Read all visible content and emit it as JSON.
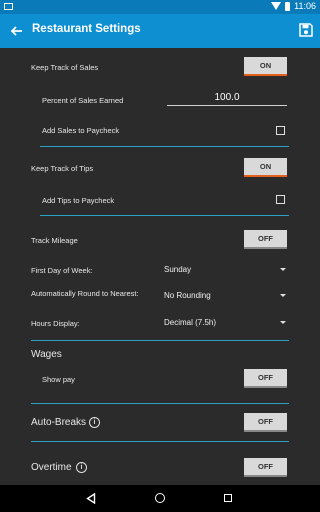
{
  "status_bar": {
    "time": "11:06"
  },
  "app_bar": {
    "title": "Restaurant Settings"
  },
  "settings": {
    "keep_track_sales": {
      "label": "Keep Track of Sales",
      "value": "ON"
    },
    "percent_sales": {
      "label": "Percent of Sales Earned",
      "value": "100.0"
    },
    "add_sales_paycheck": {
      "label": "Add Sales to Paycheck",
      "checked": false
    },
    "keep_track_tips": {
      "label": "Keep Track of Tips",
      "value": "ON"
    },
    "add_tips_paycheck": {
      "label": "Add Tips to Paycheck",
      "checked": false
    },
    "track_mileage": {
      "label": "Track Mileage",
      "value": "OFF"
    },
    "first_day": {
      "label": "First Day of Week:",
      "value": "Sunday"
    },
    "round_nearest": {
      "label": "Automatically Round to Nearest:",
      "value": "No Rounding"
    },
    "hours_display": {
      "label": "Hours Display:",
      "value": "Decimal (7.5h)"
    }
  },
  "wages": {
    "heading": "Wages",
    "show_pay": {
      "label": "Show pay",
      "value": "OFF"
    }
  },
  "auto_breaks": {
    "label": "Auto-Breaks",
    "value": "OFF",
    "info": "i"
  },
  "overtime": {
    "label": "Overtime",
    "value": "OFF",
    "info": "i"
  },
  "colors": {
    "accent": "#0e8fd1",
    "status_bar": "#0a7bb8",
    "toggle_on_underline": "#e35f1b",
    "divider": "#2aa0c8",
    "background": "#2b2b2b"
  }
}
